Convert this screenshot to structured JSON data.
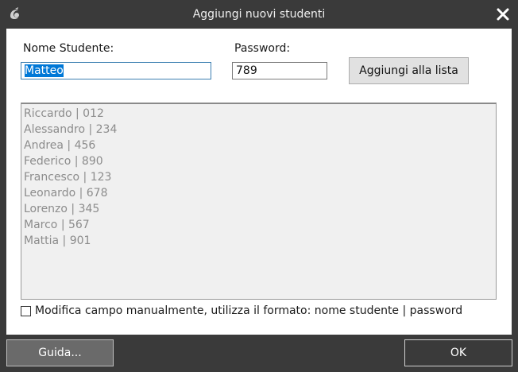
{
  "window": {
    "title": "Aggiungi nuovi studenti",
    "app_icon": "app-logo-icon",
    "close_icon": "close-icon"
  },
  "form": {
    "name_label": "Nome Studente:",
    "name_value": "Matteo",
    "password_label": "Password:",
    "password_value": "789",
    "add_button": "Aggiungi alla lista"
  },
  "students": [
    "Riccardo | 012",
    "Alessandro | 234",
    "Andrea | 456",
    "Federico | 890",
    "Francesco | 123",
    "Leonardo | 678",
    "Lorenzo | 345",
    "Marco | 567",
    "Mattia | 901"
  ],
  "manual_edit": {
    "label": "Modifica campo manualmente, utilizza il formato: nome studente | password",
    "checked": false
  },
  "footer": {
    "help_button": "Guida...",
    "ok_button": "OK"
  },
  "colors": {
    "titlebar": "#3a3a3a",
    "selection": "#0078d7"
  }
}
